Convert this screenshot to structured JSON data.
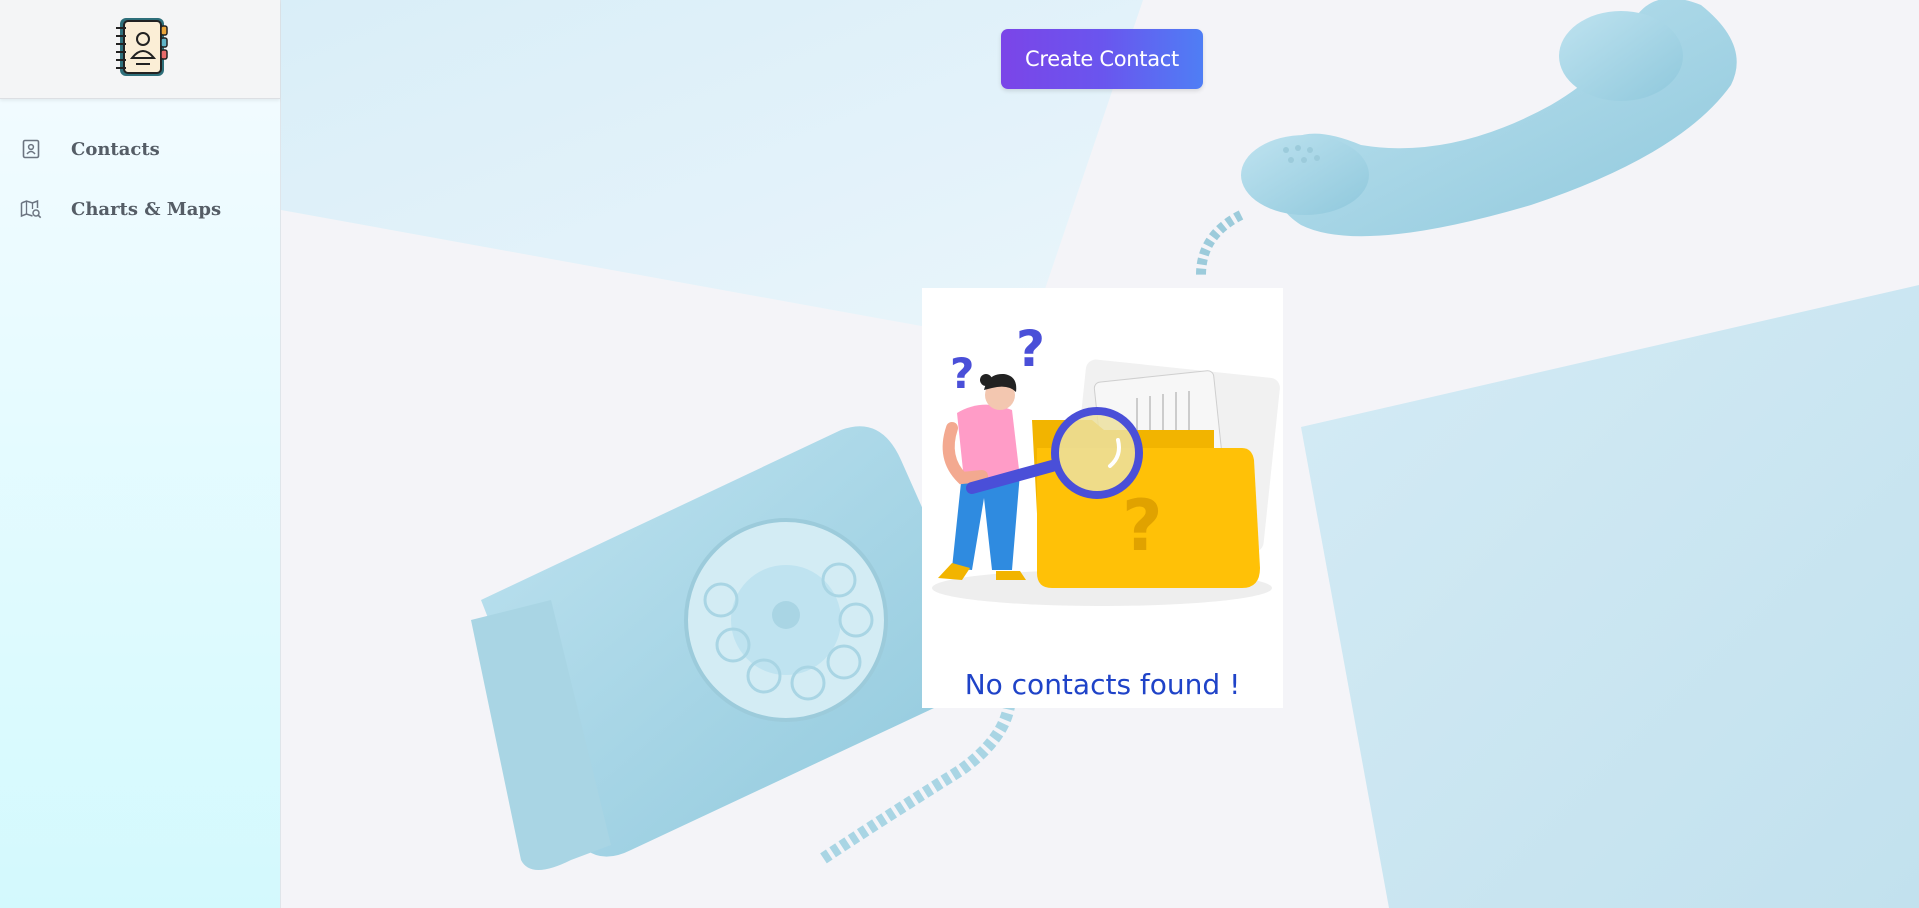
{
  "app": {
    "logo_icon": "contact-book-icon"
  },
  "sidebar": {
    "items": [
      {
        "label": "Contacts",
        "icon": "contact-card-icon"
      },
      {
        "label": "Charts & Maps",
        "icon": "map-search-icon"
      }
    ]
  },
  "main": {
    "create_button_label": "Create Contact",
    "empty_state": {
      "message": "No contacts found !",
      "illustration": "woman-with-magnifier-and-folder-icon"
    },
    "background": "rotary-telephone-photo"
  },
  "colors": {
    "button_start": "#7b45e8",
    "button_end": "#4f7ef5",
    "empty_text": "#1f43c8",
    "sidebar_text": "#555d66"
  }
}
